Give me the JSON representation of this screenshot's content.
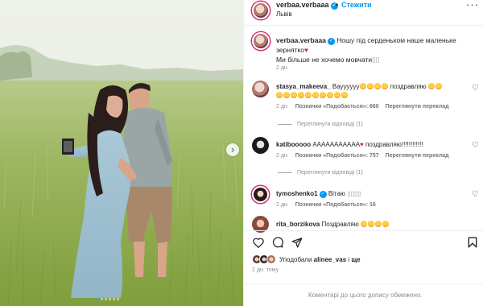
{
  "post": {
    "username": "verbaa.verbaaa",
    "follow_label": "Стежити",
    "location": "Львів",
    "caption_user": "verbaa.verbaaa",
    "caption_line1": "Ношу під серденьком наше маленьке",
    "caption_line2": "зернятко",
    "caption_line3": "Ми більше не хочемо мовчати",
    "caption_time": "2 дн.",
    "more_label": "···",
    "time": "2 дн. тому"
  },
  "comments": [
    {
      "user": "stasya_makeeva_",
      "text": "Вауууууу",
      "text2": "поздравляю",
      "time": "2 дн.",
      "likes": "Позначки «Подобається»: 660",
      "translate": "Переглянути переклад",
      "replies": "Переглянути відповіді (1)"
    },
    {
      "user": "katibooooo",
      "text": "ААААААААААА",
      "text2": "поздравляю!!!!!!!!!!!!",
      "time": "2 дн.",
      "likes": "Позначки «Подобається»: 757",
      "translate": "Переглянути переклад",
      "replies": "Переглянути відповіді (1)"
    },
    {
      "user": "tymoshenko1",
      "text": "Вітаю",
      "time": "2 дн.",
      "likes": "Позначки «Подобається»: 16"
    },
    {
      "user": "rita_borzikova",
      "text": "Поздравляю"
    }
  ],
  "likes": {
    "prefix": "Уподобали",
    "user": "alinee_vas",
    "suffix": "і",
    "others": "ще"
  },
  "footer": {
    "text": "Коментарі до цього допису обмежено."
  },
  "icons": {
    "heart": "heart-icon",
    "comment": "comment-icon",
    "share": "share-icon",
    "save": "bookmark-icon",
    "next": "chevron-right-icon"
  },
  "colors": {
    "accent": "#0095f6",
    "meta": "#8e8e8e",
    "like_red": "#ed4956"
  },
  "carousel": {
    "total": 6,
    "current": 1
  }
}
